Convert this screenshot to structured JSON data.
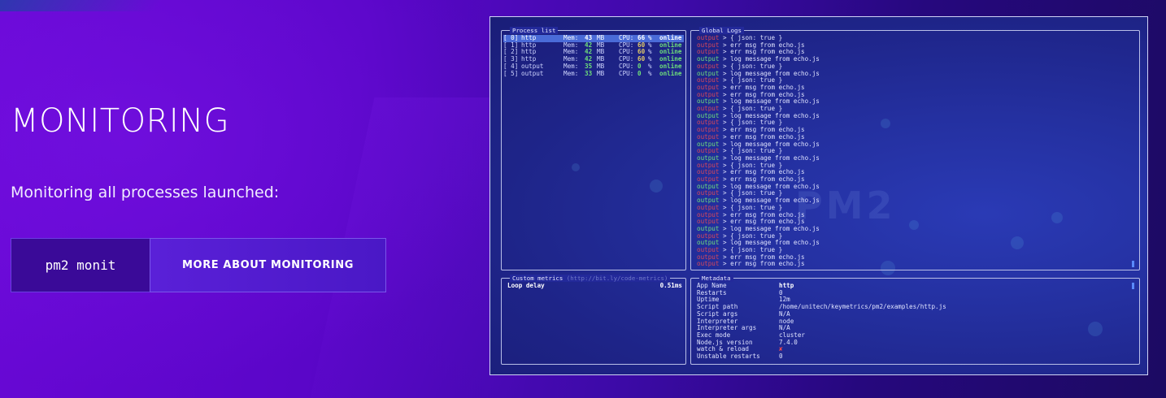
{
  "heading": "MONITORING",
  "subtext": "Monitoring all processes launched:",
  "command": "pm2 monit",
  "cta_label": "MORE ABOUT MONITORING",
  "colors": {
    "accent": "#5a20d8",
    "background": "#5a06c8",
    "terminal_bg": "#2430a0",
    "online": "#6fe07a",
    "error": "#d8485a"
  },
  "terminal": {
    "watermark": "PM2",
    "process_list": {
      "title": "Process list",
      "rows": [
        {
          "id": "[ 0]",
          "name": "http",
          "mem_label": "Mem:",
          "mem": "43",
          "mem_unit": "MB",
          "cpu_label": "CPU:",
          "cpu": "66",
          "cpu_unit": "%",
          "status": "online"
        },
        {
          "id": "[ 1]",
          "name": "http",
          "mem_label": "Mem:",
          "mem": "42",
          "mem_unit": "MB",
          "cpu_label": "CPU:",
          "cpu": "60",
          "cpu_unit": "%",
          "status": "online"
        },
        {
          "id": "[ 2]",
          "name": "http",
          "mem_label": "Mem:",
          "mem": "42",
          "mem_unit": "MB",
          "cpu_label": "CPU:",
          "cpu": "60",
          "cpu_unit": "%",
          "status": "online"
        },
        {
          "id": "[ 3]",
          "name": "http",
          "mem_label": "Mem:",
          "mem": "42",
          "mem_unit": "MB",
          "cpu_label": "CPU:",
          "cpu": "60",
          "cpu_unit": "%",
          "status": "online"
        },
        {
          "id": "[ 4]",
          "name": "output",
          "mem_label": "Mem:",
          "mem": "35",
          "mem_unit": "MB",
          "cpu_label": "CPU:",
          "cpu": "0",
          "cpu_unit": "%",
          "status": "online"
        },
        {
          "id": "[ 5]",
          "name": "output",
          "mem_label": "Mem:",
          "mem": "33",
          "mem_unit": "MB",
          "cpu_label": "CPU:",
          "cpu": "0",
          "cpu_unit": "%",
          "status": "online"
        }
      ]
    },
    "global_logs": {
      "title": "Global Logs",
      "lines": [
        {
          "src": "output",
          "kind": "err",
          "text": "> { json: true }"
        },
        {
          "src": "output",
          "kind": "err",
          "text": "> err msg from echo.js"
        },
        {
          "src": "output",
          "kind": "err",
          "text": "> err msg from echo.js"
        },
        {
          "src": "output",
          "kind": "out",
          "text": "> log message from echo.js"
        },
        {
          "src": "output",
          "kind": "err",
          "text": "> { json: true }"
        },
        {
          "src": "output",
          "kind": "out",
          "text": "> log message from echo.js"
        },
        {
          "src": "output",
          "kind": "err",
          "text": "> { json: true }"
        },
        {
          "src": "output",
          "kind": "err",
          "text": "> err msg from echo.js"
        },
        {
          "src": "output",
          "kind": "err",
          "text": "> err msg from echo.js"
        },
        {
          "src": "output",
          "kind": "out",
          "text": "> log message from echo.js"
        },
        {
          "src": "output",
          "kind": "err",
          "text": "> { json: true }"
        },
        {
          "src": "output",
          "kind": "out",
          "text": "> log message from echo.js"
        },
        {
          "src": "output",
          "kind": "err",
          "text": "> { json: true }"
        },
        {
          "src": "output",
          "kind": "err",
          "text": "> err msg from echo.js"
        },
        {
          "src": "output",
          "kind": "err",
          "text": "> err msg from echo.js"
        },
        {
          "src": "output",
          "kind": "out",
          "text": "> log message from echo.js"
        },
        {
          "src": "output",
          "kind": "err",
          "text": "> { json: true }"
        },
        {
          "src": "output",
          "kind": "out",
          "text": "> log message from echo.js"
        },
        {
          "src": "output",
          "kind": "err",
          "text": "> { json: true }"
        },
        {
          "src": "output",
          "kind": "err",
          "text": "> err msg from echo.js"
        },
        {
          "src": "output",
          "kind": "err",
          "text": "> err msg from echo.js"
        },
        {
          "src": "output",
          "kind": "out",
          "text": "> log message from echo.js"
        },
        {
          "src": "output",
          "kind": "err",
          "text": "> { json: true }"
        },
        {
          "src": "output",
          "kind": "out",
          "text": "> log message from echo.js"
        },
        {
          "src": "output",
          "kind": "err",
          "text": "> { json: true }"
        },
        {
          "src": "output",
          "kind": "err",
          "text": "> err msg from echo.js"
        },
        {
          "src": "output",
          "kind": "err",
          "text": "> err msg from echo.js"
        },
        {
          "src": "output",
          "kind": "out",
          "text": "> log message from echo.js"
        },
        {
          "src": "output",
          "kind": "err",
          "text": "> { json: true }"
        },
        {
          "src": "output",
          "kind": "out",
          "text": "> log message from echo.js"
        },
        {
          "src": "output",
          "kind": "err",
          "text": "> { json: true }"
        },
        {
          "src": "output",
          "kind": "err",
          "text": "> err msg from echo.js"
        },
        {
          "src": "output",
          "kind": "err",
          "text": "> err msg from echo.js"
        }
      ]
    },
    "custom_metrics": {
      "title": "Custom metrics",
      "title_link": "(http://bit.ly/code-metrics)",
      "items": [
        {
          "label": "Loop delay",
          "value": "0.51ms"
        }
      ]
    },
    "metadata": {
      "title": "Metadata",
      "rows": [
        {
          "key": "App Name",
          "value": "http"
        },
        {
          "key": "Restarts",
          "value": "0"
        },
        {
          "key": "Uptime",
          "value": "12m"
        },
        {
          "key": "Script path",
          "value": "/home/unitech/keymetrics/pm2/examples/http.js"
        },
        {
          "key": "Script args",
          "value": "N/A"
        },
        {
          "key": "Interpreter",
          "value": "node"
        },
        {
          "key": "Interpreter args",
          "value": "N/A"
        },
        {
          "key": "Exec mode",
          "value": "cluster"
        },
        {
          "key": "Node.js version",
          "value": "7.4.0"
        },
        {
          "key": "watch & reload",
          "value": "✘"
        },
        {
          "key": "Unstable restarts",
          "value": "0"
        }
      ]
    }
  }
}
